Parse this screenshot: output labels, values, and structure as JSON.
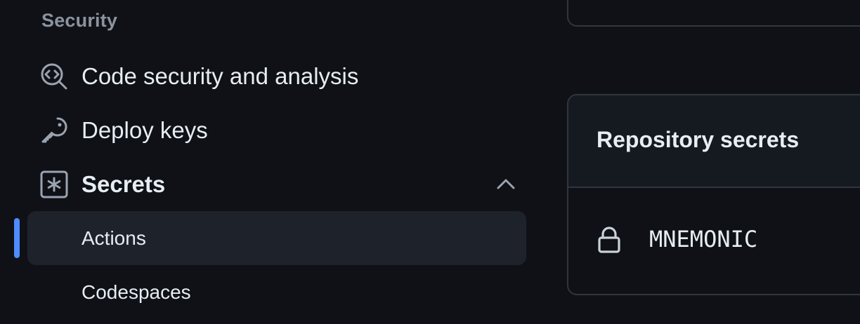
{
  "sidebar": {
    "section_heading": "Security",
    "items": [
      {
        "label": "Code security and analysis",
        "icon": "codescan-icon"
      },
      {
        "label": "Deploy keys",
        "icon": "key-icon"
      },
      {
        "label": "Secrets",
        "icon": "asterisk-box-icon",
        "expanded": true
      }
    ],
    "secrets_subitems": [
      {
        "label": "Actions",
        "active": true
      },
      {
        "label": "Codespaces",
        "active": false
      }
    ]
  },
  "main": {
    "repository_secrets": {
      "title": "Repository secrets",
      "secrets": [
        {
          "name": "MNEMONIC",
          "icon": "lock-icon"
        }
      ]
    }
  },
  "colors": {
    "background": "#0f1117",
    "active_marker": "#4c8dff",
    "active_item_bg": "#1e222b",
    "border": "#30363d",
    "muted_text": "#8b949e",
    "text": "#e6edf3"
  }
}
